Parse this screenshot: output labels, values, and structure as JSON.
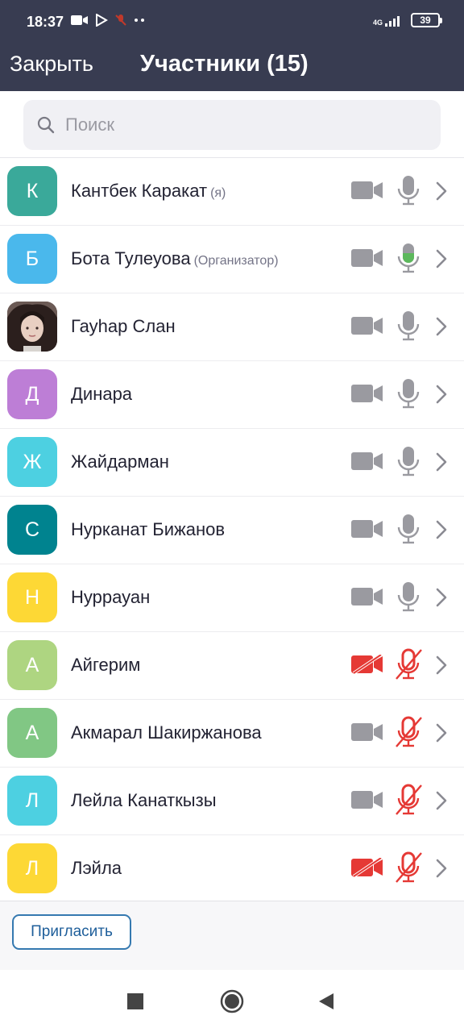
{
  "status_bar": {
    "time": "18:37",
    "network": "4G",
    "battery": "39"
  },
  "header": {
    "close_label": "Закрыть",
    "title": "Участники (15)"
  },
  "search": {
    "placeholder": "Поиск"
  },
  "colors": {
    "header_bg": "#383c51",
    "mic_active": "#5cb85c",
    "muted_red": "#e53935",
    "icon_gray": "#9a9aa0",
    "link_blue": "#1e5e9a"
  },
  "participants": [
    {
      "initial": "К",
      "name": "Кантбек Каракат",
      "role": "(я)",
      "avatar_color": "#3aa99a",
      "video_off": false,
      "mic": "on"
    },
    {
      "initial": "Б",
      "name": "Бота Тулеуова",
      "role": "(Организатор)",
      "avatar_color": "#4ab8ec",
      "video_off": false,
      "mic": "speaking"
    },
    {
      "initial": "",
      "name": "Гауһар Слан",
      "role": "",
      "avatar_color": "#6b5a55",
      "avatar_photo": true,
      "video_off": false,
      "mic": "on"
    },
    {
      "initial": "Д",
      "name": "Динара",
      "role": "",
      "avatar_color": "#bd7ed6",
      "video_off": false,
      "mic": "on"
    },
    {
      "initial": "Ж",
      "name": "Жайдарман",
      "role": "",
      "avatar_color": "#4dd0e1",
      "video_off": false,
      "mic": "on"
    },
    {
      "initial": "С",
      "name": "Нурканат Бижанов",
      "role": "",
      "avatar_color": "#00838f",
      "video_off": false,
      "mic": "on"
    },
    {
      "initial": "Н",
      "name": "Нуррауан",
      "role": "",
      "avatar_color": "#fdd835",
      "video_off": false,
      "mic": "on"
    },
    {
      "initial": "А",
      "name": "Айгерим",
      "role": "",
      "avatar_color": "#aed581",
      "video_off": true,
      "mic": "muted"
    },
    {
      "initial": "А",
      "name": "Акмарал Шакиржанова",
      "role": "",
      "avatar_color": "#81c784",
      "video_off": false,
      "mic": "muted"
    },
    {
      "initial": "Л",
      "name": "Лейла Канаткызы",
      "role": "",
      "avatar_color": "#4dd0e1",
      "video_off": false,
      "mic": "muted"
    },
    {
      "initial": "Л",
      "name": "Лэйла",
      "role": "",
      "avatar_color": "#fdd835",
      "video_off": true,
      "mic": "muted"
    }
  ],
  "footer": {
    "invite_label": "Пригласить"
  },
  "nav": {
    "icons": [
      "recents-square-icon",
      "home-circle-icon",
      "back-triangle-icon"
    ]
  }
}
